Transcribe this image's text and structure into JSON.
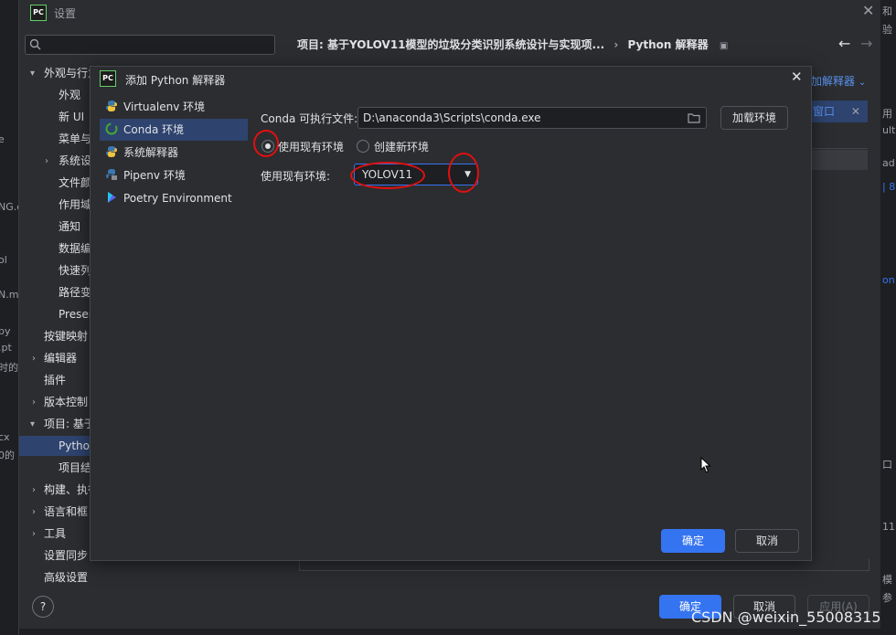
{
  "settings": {
    "title": "设置",
    "logo": "PC",
    "breadcrumb_project": "项目: 基于YOLOV11模型的垃圾分类识别系统设计与实现项...",
    "breadcrumb_sep": "›",
    "breadcrumb_page": "Python 解释器",
    "add_interpreter": "加解释器",
    "panel_fragment": "窗口",
    "tree": [
      "外观与行为",
      "外观",
      "新 UI",
      "菜单与",
      "系统设",
      "文件颜",
      "作用域",
      "通知",
      "数据编",
      "快速列",
      "路径变",
      "Preser",
      "按键映射",
      "编辑器",
      "插件",
      "版本控制",
      "项目: 基于",
      "Pythor",
      "项目结",
      "构建、执行",
      "语言和框",
      "工具",
      "设置同步",
      "高级设置"
    ],
    "buttons": {
      "ok": "确定",
      "cancel": "取消",
      "apply": "应用(A)"
    },
    "help": "?"
  },
  "dialog": {
    "title": "添加 Python 解释器",
    "types": [
      {
        "label": "Virtualenv 环境",
        "icon": "python-icon"
      },
      {
        "label": "Conda 环境",
        "icon": "conda-icon"
      },
      {
        "label": "系统解释器",
        "icon": "python-icon"
      },
      {
        "label": "Pipenv 环境",
        "icon": "pipenv-icon"
      },
      {
        "label": "Poetry Environment",
        "icon": "poetry-icon"
      }
    ],
    "conda_label": "Conda 可执行文件:",
    "conda_path": "D:\\anaconda3\\Scripts\\conda.exe",
    "load_env": "加载环境",
    "use_existing": "使用现有环境",
    "create_new": "创建新环境",
    "env_label": "使用现有环境:",
    "env_value": "YOLOV11",
    "ok": "确定",
    "cancel": "取消"
  },
  "watermark": "CSDN @weixin_55008315",
  "outside_left": [
    "e",
    "NG.c",
    "ol",
    "N.m",
    "py",
    ".pt",
    "时的",
    "cx",
    "0的"
  ],
  "outside_right": [
    "和",
    "验",
    "用",
    "ult",
    "ad",
    "| 8",
    "on",
    "口",
    "11",
    "模",
    "参"
  ]
}
